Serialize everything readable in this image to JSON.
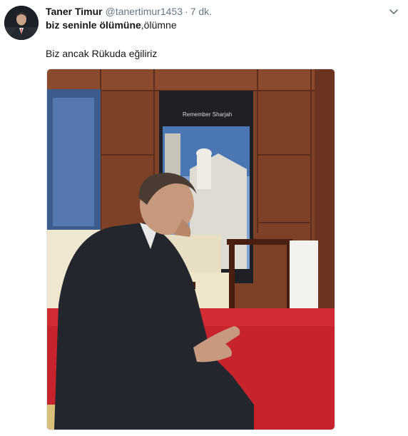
{
  "tweet": {
    "author_name": "Taner Timur",
    "author_handle": "@tanertimur1453",
    "separator": "·",
    "time": "7 dk.",
    "text_line1_bold": "biz seninle ölümüne",
    "text_line1_rest": ",ölümne",
    "text_line2": "Biz ancak Rükuda eğiliriz",
    "poster_caption": "Remember Sharjah",
    "icons": {
      "menu": "chevron-down-icon",
      "avatar": "avatar"
    }
  },
  "colors": {
    "name": "#14171a",
    "secondary": "#657786",
    "carpet": "#c8232c",
    "wood": "#7a3c22"
  }
}
